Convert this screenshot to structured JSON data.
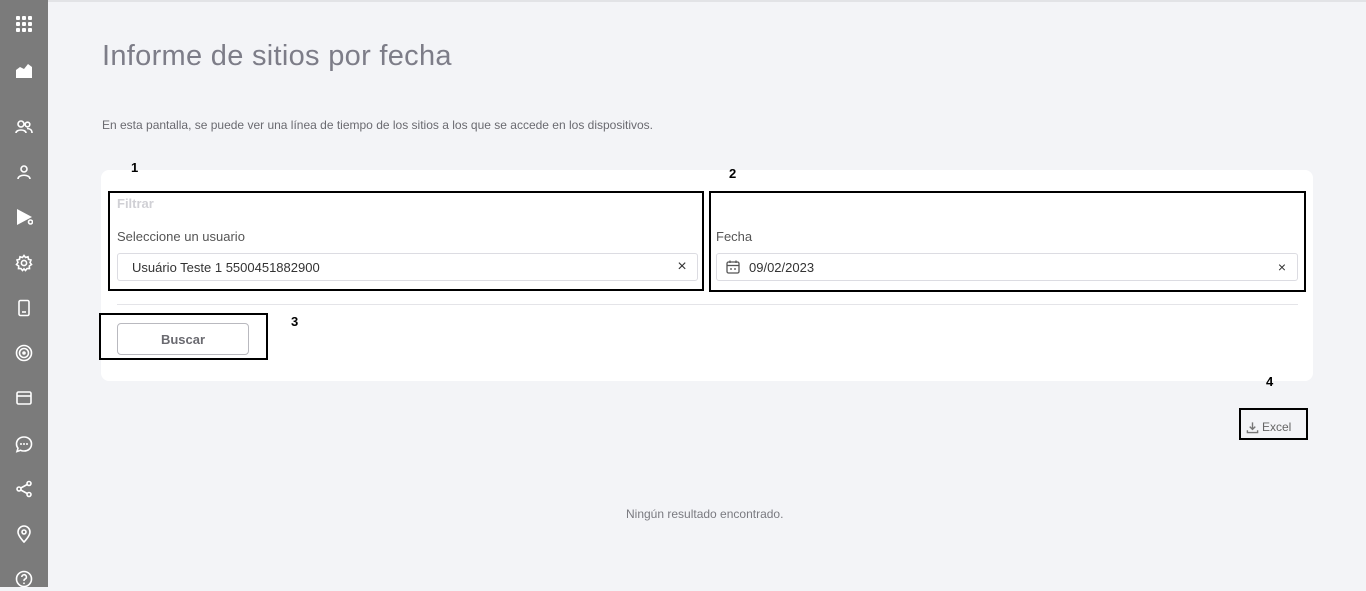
{
  "sidebar": {
    "items": [
      {
        "icon": "apps-grid-icon"
      },
      {
        "icon": "dashboard-icon"
      },
      {
        "icon": "groups-icon"
      },
      {
        "icon": "user-icon"
      },
      {
        "icon": "play-store-icon"
      },
      {
        "icon": "settings-icon"
      },
      {
        "icon": "device-icon"
      },
      {
        "icon": "location-radar-icon"
      },
      {
        "icon": "browser-window-icon"
      },
      {
        "icon": "chat-icon"
      },
      {
        "icon": "share-icon"
      },
      {
        "icon": "map-pin-icon"
      },
      {
        "icon": "help-icon"
      }
    ]
  },
  "page": {
    "title": "Informe de sitios por fecha",
    "description": "En esta pantalla, se puede ver una línea de tiempo de los sitios a los que se accede en los dispositivos."
  },
  "annotations": [
    "1",
    "2",
    "3",
    "4"
  ],
  "filter": {
    "heading": "Filtrar",
    "user_label": "Seleccione un usuario",
    "user_value": "Usuário Teste 1 5500451882900",
    "date_label": "Fecha",
    "date_value": "09/02/2023",
    "clear_symbol": "×"
  },
  "actions": {
    "search_label": "Buscar",
    "excel_label": "Excel"
  },
  "results": {
    "empty_message": "Ningún resultado encontrado."
  }
}
